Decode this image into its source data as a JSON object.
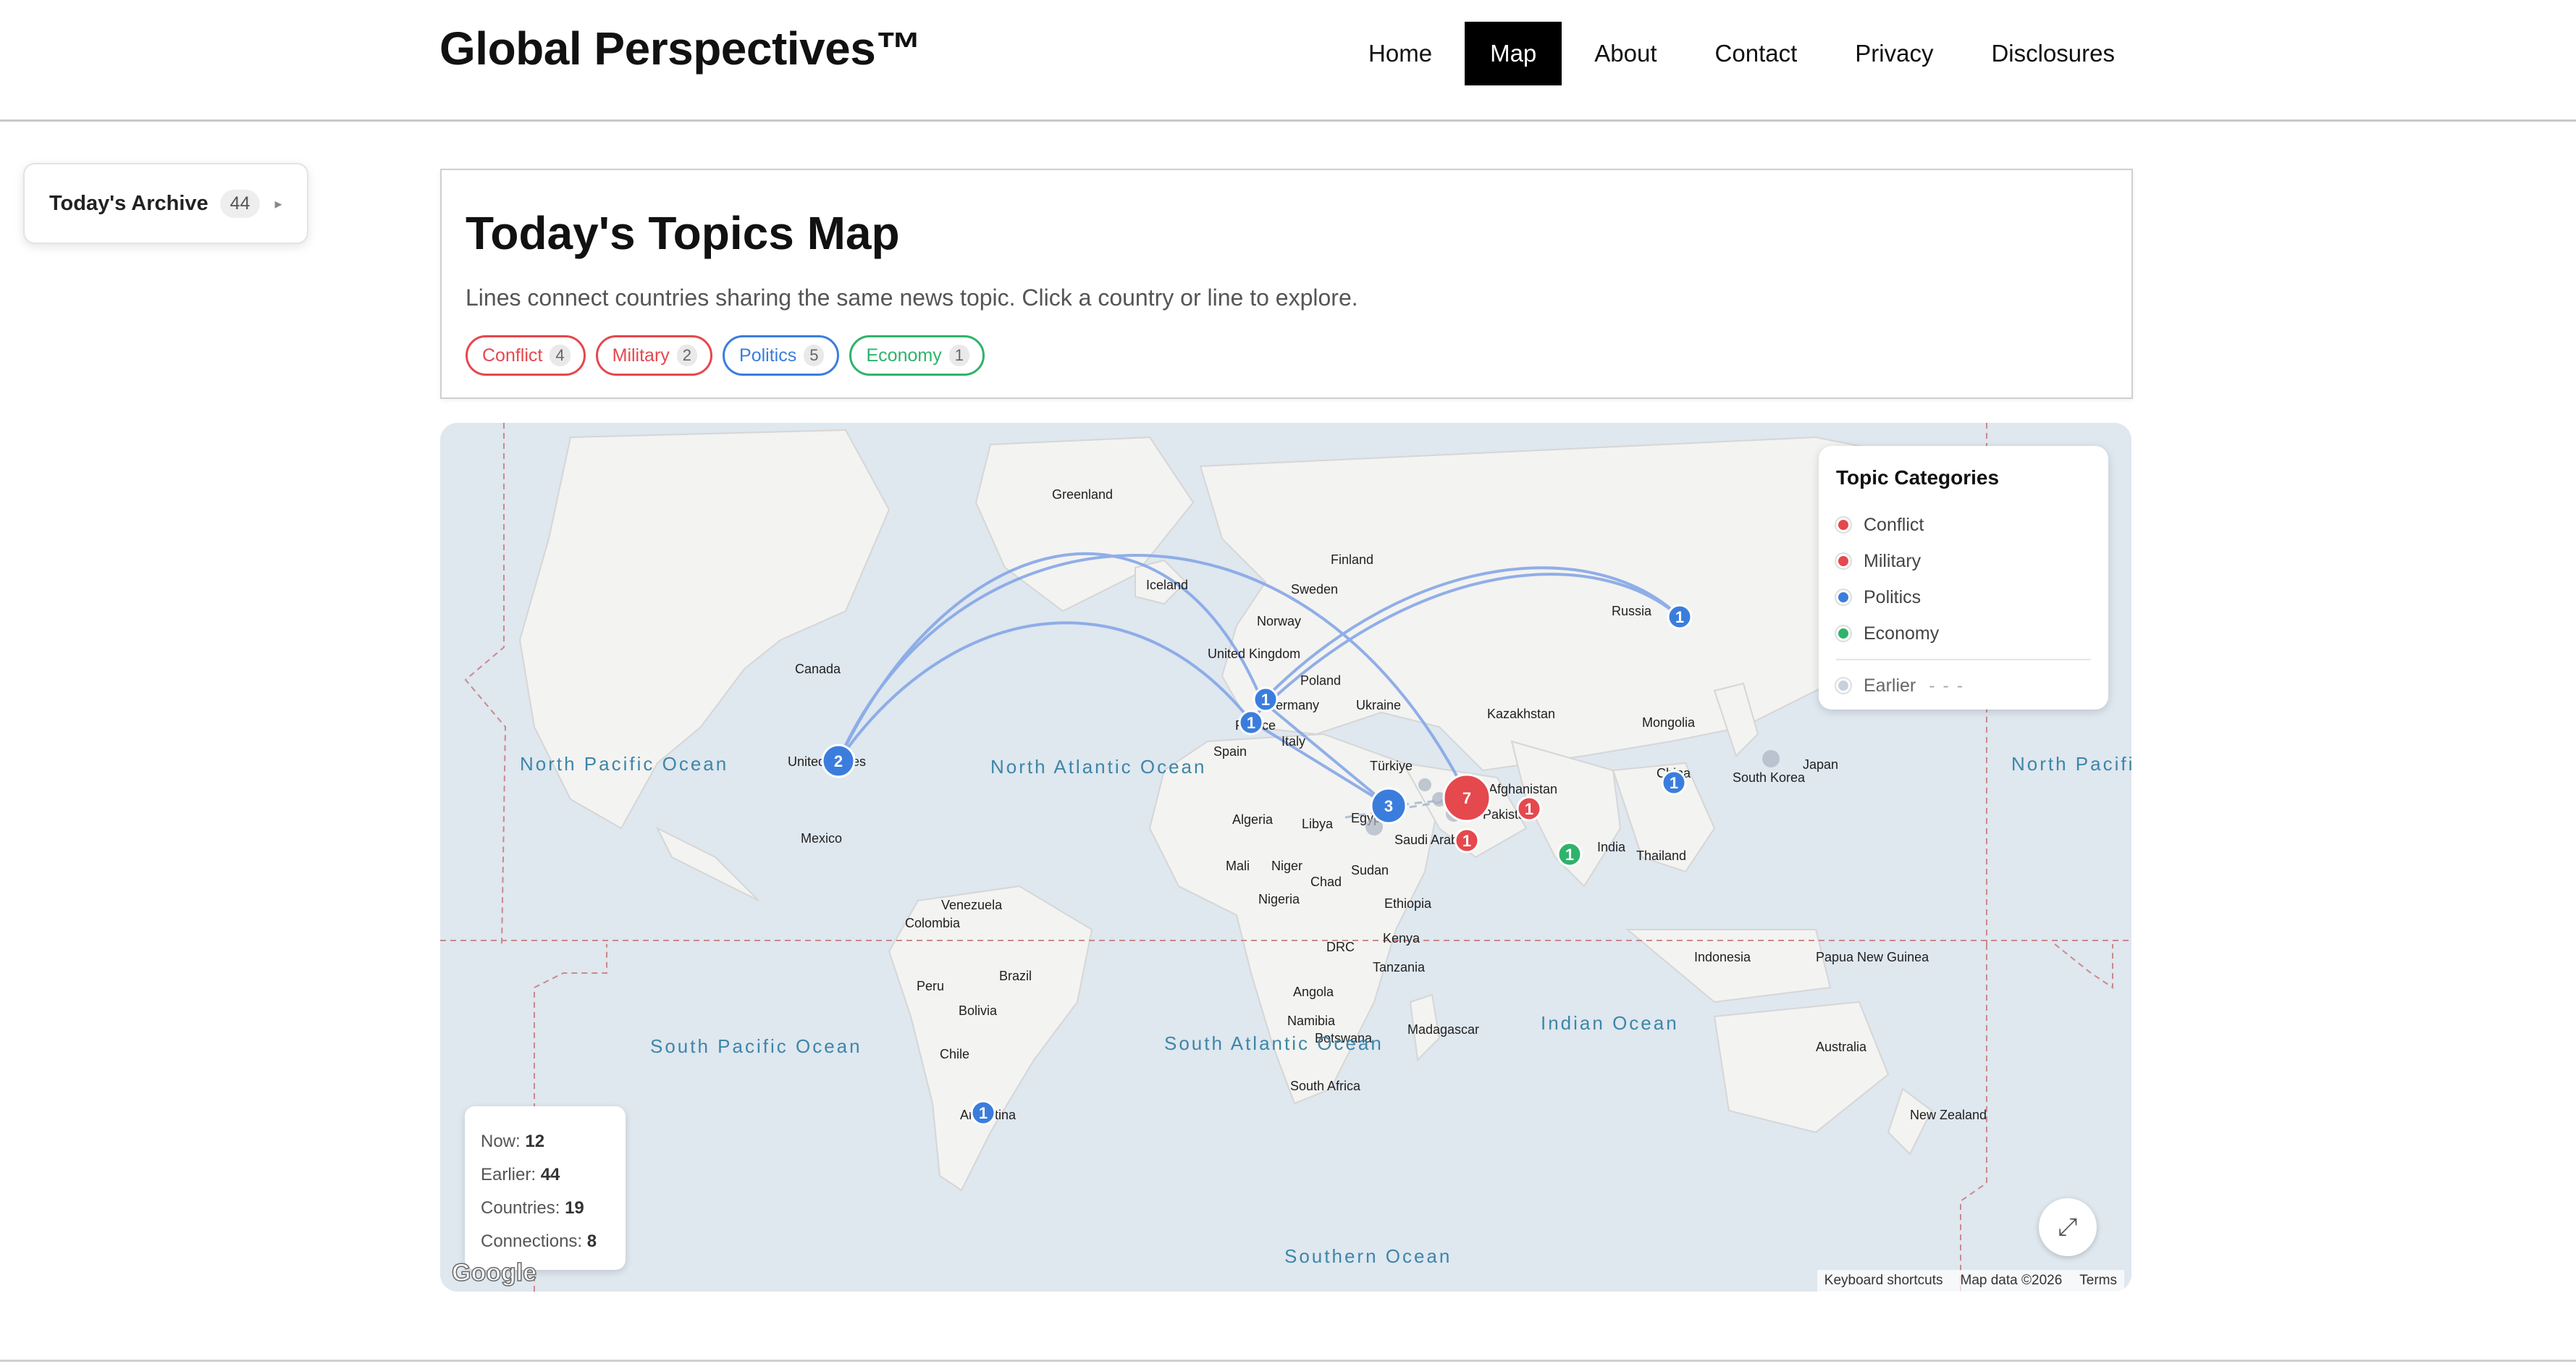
{
  "site": {
    "brand": "Global Perspectives™",
    "nav": [
      {
        "label": "Home",
        "active": false
      },
      {
        "label": "Map",
        "active": true
      },
      {
        "label": "About",
        "active": false
      },
      {
        "label": "Contact",
        "active": false
      },
      {
        "label": "Privacy",
        "active": false
      },
      {
        "label": "Disclosures",
        "active": false
      }
    ]
  },
  "archive": {
    "label": "Today's Archive",
    "count": "44",
    "arrow": "▸"
  },
  "intro": {
    "title": "Today's Topics Map",
    "subtitle": "Lines connect countries sharing the same news topic. Click a country or line to explore.",
    "chips": [
      {
        "label": "Conflict",
        "count": "4",
        "color": "#e5484d"
      },
      {
        "label": "Military",
        "count": "2",
        "color": "#e5484d"
      },
      {
        "label": "Politics",
        "count": "5",
        "color": "#3b7ddd"
      },
      {
        "label": "Economy",
        "count": "1",
        "color": "#2fb36b"
      }
    ]
  },
  "legend": {
    "title": "Topic Categories",
    "items": [
      {
        "label": "Conflict",
        "color": "#e5484d"
      },
      {
        "label": "Military",
        "color": "#e5484d"
      },
      {
        "label": "Politics",
        "color": "#3b7ddd"
      },
      {
        "label": "Economy",
        "color": "#2fb36b"
      }
    ],
    "earlier": {
      "label": "Earlier",
      "dash": "- - -",
      "color": "#c7d0dc"
    }
  },
  "stats": [
    {
      "label": "Now:",
      "value": "12"
    },
    {
      "label": "Earlier:",
      "value": "44"
    },
    {
      "label": "Countries:",
      "value": "19"
    },
    {
      "label": "Connections:",
      "value": "8"
    }
  ],
  "map": {
    "countries": [
      "Greenland",
      "Iceland",
      "Finland",
      "Sweden",
      "Norway",
      "Russia",
      "United Kingdom",
      "Poland",
      "Germany",
      "Ukraine",
      "Kazakhstan",
      "Mongolia",
      "France",
      "Spain",
      "Italy",
      "Türkiye",
      "China",
      "Japan",
      "South Korea",
      "Afghanistan",
      "Pakistan",
      "Canada",
      "United States",
      "Mexico",
      "Algeria",
      "Libya",
      "Egypt",
      "Saudi Arabia",
      "Mali",
      "Niger",
      "Chad",
      "Sudan",
      "Ethiopia",
      "Nigeria",
      "India",
      "Thailand",
      "Venezuela",
      "Colombia",
      "Brazil",
      "Peru",
      "Bolivia",
      "Chile",
      "Argentina",
      "Kenya",
      "DRC",
      "Tanzania",
      "Angola",
      "Namibia",
      "Botswana",
      "Madagascar",
      "South Africa",
      "Indonesia",
      "Papua New Guinea",
      "Australia",
      "New Zealand"
    ],
    "oceans": [
      "North Pacific Ocean",
      "North Atlantic Ocean",
      "North Pacific Ocean",
      "South Pacific Ocean",
      "South Atlantic Ocean",
      "Indian Ocean",
      "Southern Ocean"
    ],
    "markers": [
      {
        "country": "Russia",
        "count": "1",
        "topic": "Politics"
      },
      {
        "country": "United Kingdom",
        "count": "1",
        "topic": "Politics"
      },
      {
        "country": "France",
        "count": "1",
        "topic": "Politics"
      },
      {
        "country": "United States",
        "count": "2",
        "topic": "Politics"
      },
      {
        "country": "Egypt",
        "count": "3",
        "topic": "Politics"
      },
      {
        "country": "Iran",
        "count": "7",
        "topic": "Conflict"
      },
      {
        "country": "Pakistan",
        "count": "1",
        "topic": "Conflict"
      },
      {
        "country": "Saudi Arabia",
        "count": "1",
        "topic": "Conflict"
      },
      {
        "country": "China",
        "count": "1",
        "topic": "Politics"
      },
      {
        "country": "India",
        "count": "1",
        "topic": "Economy"
      },
      {
        "country": "Argentina",
        "count": "1",
        "topic": "Politics"
      }
    ],
    "attribution": {
      "shortcuts": "Keyboard shortcuts",
      "data": "Map data ©2026",
      "terms": "Terms"
    },
    "logo": "Google",
    "control_icon": "fullscreen-icon"
  }
}
